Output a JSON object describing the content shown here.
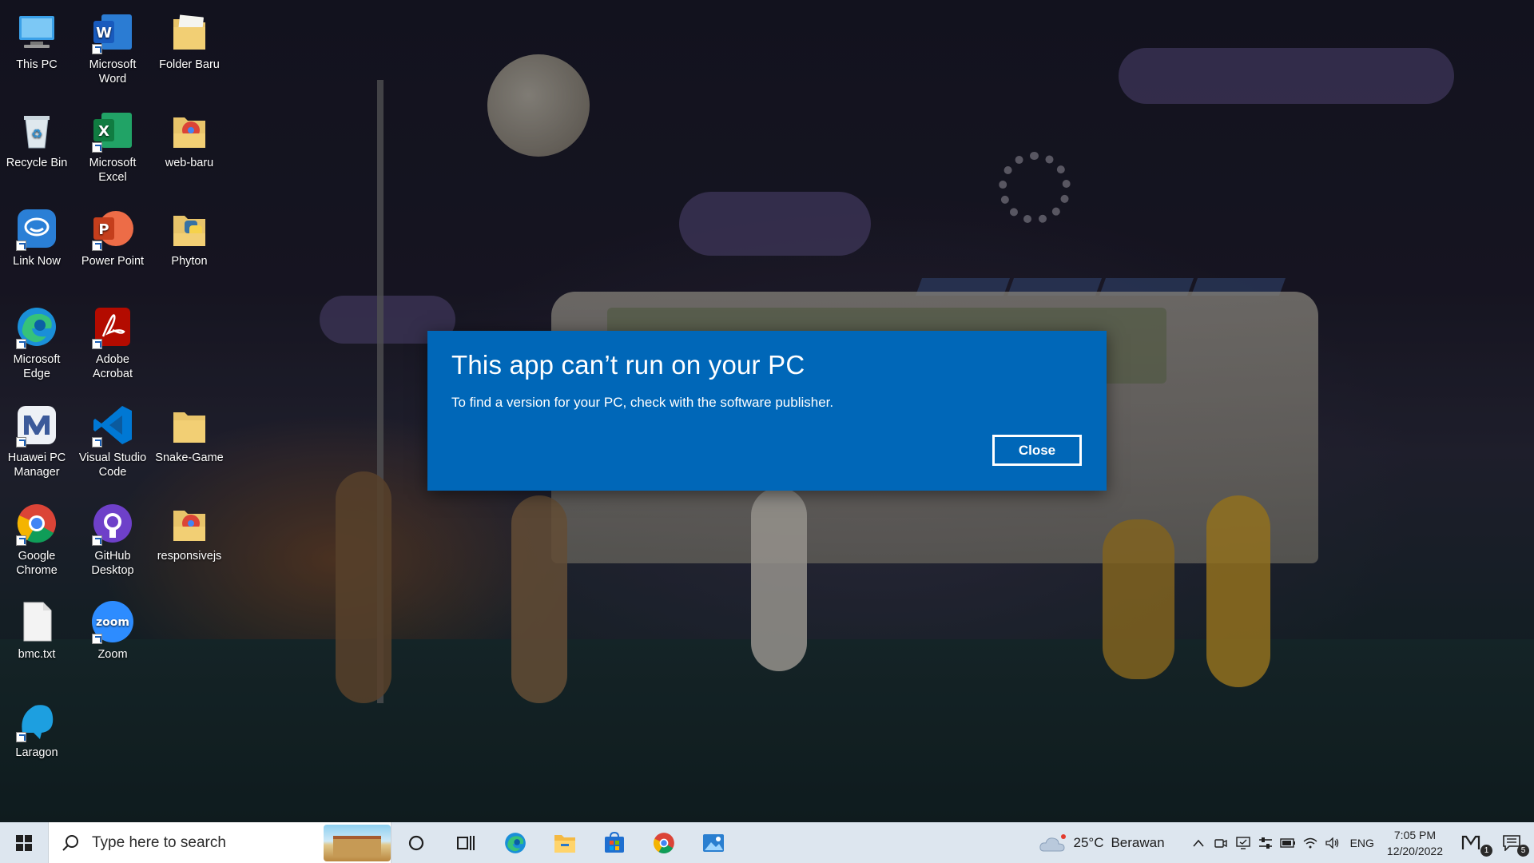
{
  "desktop": {
    "icons": [
      {
        "label": "This PC"
      },
      {
        "label": "Microsoft Word"
      },
      {
        "label": "Folder Baru"
      },
      {
        "label": "Recycle Bin"
      },
      {
        "label": "Microsoft Excel"
      },
      {
        "label": "web-baru"
      },
      {
        "label": "Link Now"
      },
      {
        "label": "Power Point"
      },
      {
        "label": "Phyton"
      },
      {
        "label": "Microsoft Edge"
      },
      {
        "label": "Adobe Acrobat"
      },
      {
        "label": "Huawei PC Manager"
      },
      {
        "label": "Visual Studio Code"
      },
      {
        "label": "Snake-Game"
      },
      {
        "label": "Google Chrome"
      },
      {
        "label": "GitHub Desktop"
      },
      {
        "label": "responsivejs"
      },
      {
        "label": "bmc.txt"
      },
      {
        "label": "Zoom"
      },
      {
        "label": "Laragon"
      }
    ]
  },
  "dialog": {
    "title": "This app can’t run on your PC",
    "message": "To find a version for your PC, check with the software publisher.",
    "close_label": "Close",
    "background": "#0067b8"
  },
  "taskbar": {
    "search_placeholder": "Type here to search",
    "pinned": [
      "task-view",
      "edge",
      "file-explorer",
      "store",
      "chrome",
      "photos"
    ],
    "weather": {
      "temp": "25°C",
      "condition": "Berawan"
    },
    "language": "ENG",
    "time": "7:05 PM",
    "date": "12/20/2022",
    "notifications_count": "5",
    "app_badge": "1"
  }
}
